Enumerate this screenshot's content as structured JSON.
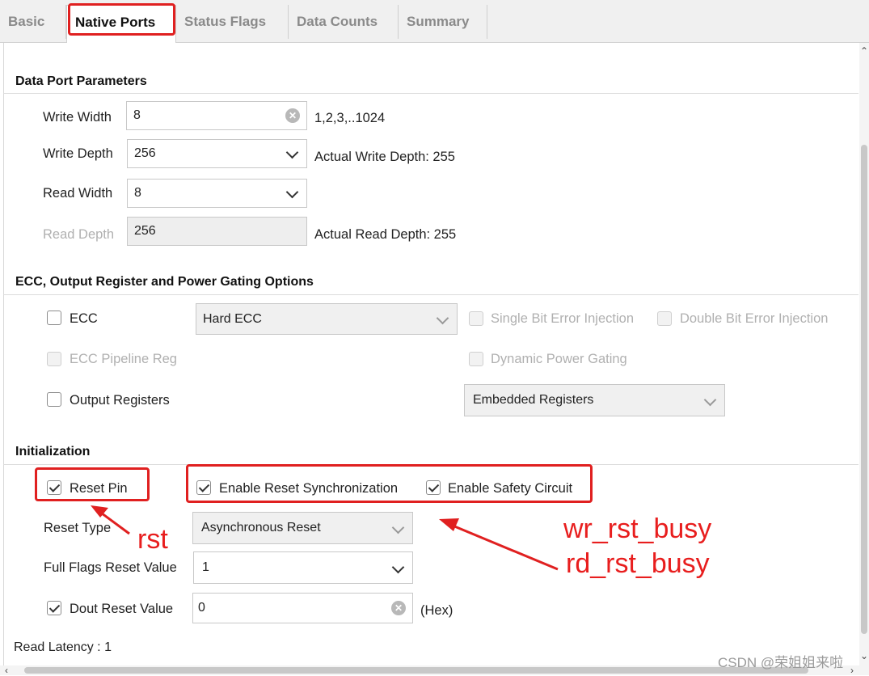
{
  "tabs": [
    "Basic",
    "Native Ports",
    "Status Flags",
    "Data Counts",
    "Summary"
  ],
  "data_port": {
    "title": "Data Port Parameters",
    "write_width_label": "Write Width",
    "write_width_value": "8",
    "write_width_hint": "1,2,3,..1024",
    "write_depth_label": "Write Depth",
    "write_depth_value": "256",
    "write_depth_actual": "Actual Write Depth: 255",
    "read_width_label": "Read Width",
    "read_width_value": "8",
    "read_depth_label": "Read Depth",
    "read_depth_value": "256",
    "read_depth_actual": "Actual Read Depth: 255"
  },
  "ecc": {
    "title": "ECC, Output Register and Power Gating Options",
    "ecc_label": "ECC",
    "ecc_type_value": "Hard ECC",
    "single_bit_label": "Single Bit Error Injection",
    "double_bit_label": "Double Bit Error Injection",
    "pipeline_label": "ECC Pipeline Reg",
    "dynamic_power_label": "Dynamic Power Gating",
    "output_registers_label": "Output Registers",
    "output_registers_value": "Embedded Registers"
  },
  "init": {
    "title": "Initialization",
    "reset_pin_label": "Reset Pin",
    "reset_sync_label": "Enable Reset Synchronization",
    "safety_circuit_label": "Enable Safety Circuit",
    "reset_type_label": "Reset Type",
    "reset_type_value": "Asynchronous Reset",
    "full_flags_label": "Full Flags Reset Value",
    "full_flags_value": "1",
    "dout_reset_label": "Dout Reset Value",
    "dout_reset_value": "0",
    "dout_reset_unit": "(Hex)",
    "read_latency": "Read Latency : 1"
  },
  "annotations": {
    "rst": "rst",
    "wr_rst_busy": "wr_rst_busy",
    "rd_rst_busy": "rd_rst_busy"
  },
  "watermark": "CSDN @荣姐姐来啦",
  "colors": {
    "annotation": "#e02020"
  }
}
